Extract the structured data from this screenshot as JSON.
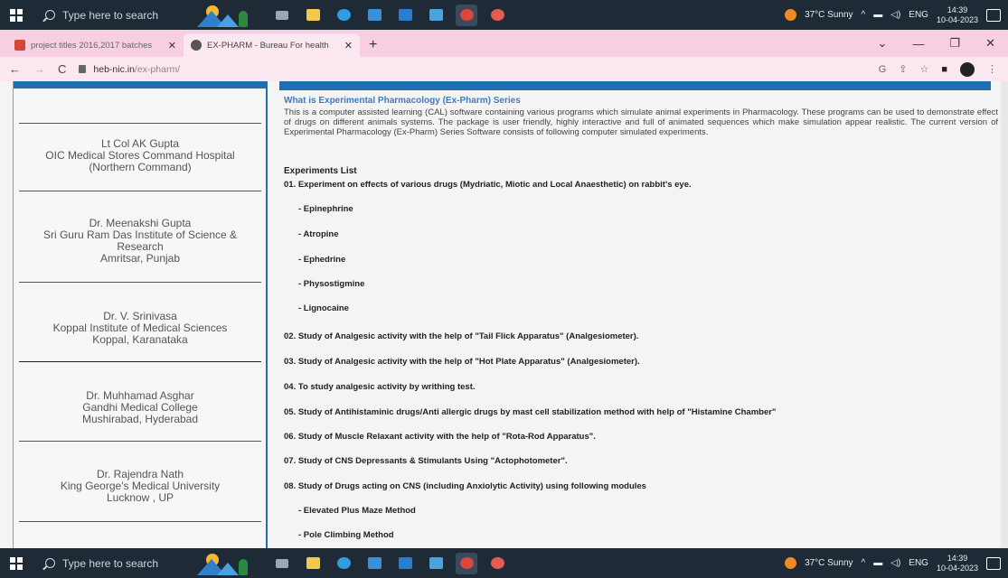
{
  "taskbar": {
    "search_placeholder": "Type here to search",
    "weather": "37°C  Sunny",
    "lang": "ENG",
    "time": "14:39",
    "date": "10-04-2023",
    "apps": [
      {
        "name": "task-view-icon",
        "color": "#9aa7b4"
      },
      {
        "name": "file-explorer-icon",
        "color": "#f2c94c"
      },
      {
        "name": "edge-icon",
        "color": "#2f9de0"
      },
      {
        "name": "store-icon",
        "color": "#3b8fd6"
      },
      {
        "name": "mail-icon",
        "color": "#2b7cd3"
      },
      {
        "name": "photos-icon",
        "color": "#4aa3df"
      },
      {
        "name": "chrome-icon",
        "color": "#d9483b"
      },
      {
        "name": "chrome-profile-icon",
        "color": "#e35d4f"
      }
    ]
  },
  "browser": {
    "tabs": [
      {
        "title": "project titles 2016,2017 batches",
        "favicon_color": "#d44638"
      },
      {
        "title": "EX-PHARM - Bureau For health",
        "favicon_color": "#555555"
      }
    ],
    "url_host": "heb-nic.in",
    "url_path": "/ex-pharm/"
  },
  "sidebar": {
    "people": [
      {
        "name": "Lt Col AK Gupta",
        "lines": [
          "OIC Medical Stores Command Hospital",
          "(Northern Command)"
        ]
      },
      {
        "name": "Dr. Meenakshi Gupta",
        "lines": [
          "Sri Guru Ram Das Institute of Science &",
          "Research",
          "Amritsar, Punjab"
        ]
      },
      {
        "name": "Dr. V. Srinivasa",
        "lines": [
          "Koppal Institute of Medical Sciences",
          "Koppal, Karanataka"
        ]
      },
      {
        "name": "Dr. Muhhamad Asghar",
        "lines": [
          "Gandhi Medical College",
          "Mushirabad, Hyderabad"
        ]
      },
      {
        "name": "Dr. Rajendra Nath",
        "lines": [
          "King George's Medical University",
          "Lucknow , UP"
        ]
      }
    ]
  },
  "content": {
    "section_title": "What is Experimental Pharmacology  (Ex-Pharm) Series",
    "intro": "This is a computer assisted learning (CAL) software containing various programs which simulate animal experiments in Pharmacology. These programs can be used to demonstrate effect of drugs on different animals systems. The package is user friendly, highly interactive and full of animated sequences which make simulation appear realistic. The current version of Experimental Pharmacology  (Ex-Pharm) Series Software consists of following computer simulated experiments.",
    "experiments_heading": "Experiments List",
    "items": [
      {
        "text": "01. Experiment on effects of various drugs (Mydriatic, Miotic and Local Anaesthetic) on rabbit's eye.",
        "sub": false
      },
      {
        "text": "- Epinephrine",
        "sub": true
      },
      {
        "text": "- Atropine",
        "sub": true
      },
      {
        "text": "- Ephedrine",
        "sub": true
      },
      {
        "text": "- Physostigmine",
        "sub": true
      },
      {
        "text": "- Lignocaine",
        "sub": true
      },
      {
        "text": "02. Study of Analgesic activity with the help of \"Tail Flick Apparatus\" (Analgesiometer).",
        "sub": false
      },
      {
        "text": "03. Study of Analgesic activity with the help of \"Hot Plate Apparatus\" (Analgesiometer).",
        "sub": false
      },
      {
        "text": "04. To study analgesic activity by writhing test.",
        "sub": false
      },
      {
        "text": "05. Study of Antihistaminic drugs/Anti allergic drugs by mast cell stabilization method with help of \"Histamine Chamber\"",
        "sub": false
      },
      {
        "text": "06. Study of Muscle Relaxant activity with the help of \"Rota-Rod Apparatus\".",
        "sub": false
      },
      {
        "text": "07. Study of CNS Depressants & Stimulants Using \"Actophotometer\".",
        "sub": false
      },
      {
        "text": "08. Study of Drugs acting on CNS (including Anxiolytic Activity) using following modules",
        "sub": false
      },
      {
        "text": "- Elevated Plus Maze Method",
        "sub": true
      },
      {
        "text": "- Pole Climbing Method",
        "sub": true
      }
    ]
  }
}
